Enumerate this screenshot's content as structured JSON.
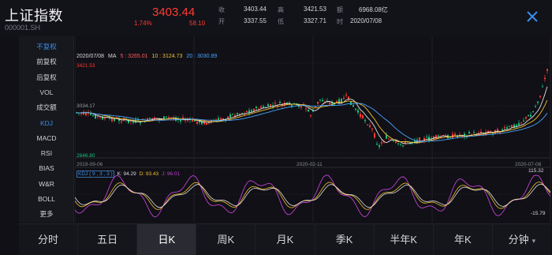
{
  "header": {
    "name": "上证指数",
    "code": "000001.SH",
    "price": "3403.44",
    "change_pct": "1.74%",
    "change": "58.10",
    "stats": [
      {
        "label": "收",
        "value": "3403.44"
      },
      {
        "label": "高",
        "value": "3421.53"
      },
      {
        "label": "额",
        "value": "6968.08亿"
      },
      {
        "label": "开",
        "value": "3337.55"
      },
      {
        "label": "低",
        "value": "3327.71"
      },
      {
        "label": "时",
        "value": "2020/07/08"
      }
    ]
  },
  "menu": {
    "items": [
      {
        "label": "不复权",
        "active": true
      },
      {
        "label": "前复权",
        "active": false
      },
      {
        "label": "后复权",
        "active": false
      },
      {
        "label": "VOL",
        "active": false
      },
      {
        "label": "成交额",
        "active": false
      },
      {
        "label": "KDJ",
        "active": true
      },
      {
        "label": "MACD",
        "active": false
      },
      {
        "label": "RSI",
        "active": false
      },
      {
        "label": "BIAS",
        "active": false
      },
      {
        "label": "W&R",
        "active": false
      },
      {
        "label": "BOLL",
        "active": false
      },
      {
        "label": "更多",
        "active": false
      }
    ]
  },
  "chart": {
    "date": "2020/07/08",
    "ma": {
      "label": "MA",
      "ma5": "5 : 3265.01",
      "ma10": "10 : 3124.73",
      "ma20": "20 : 3030.89"
    },
    "price_high_label": "3421.53",
    "price_mid_label": "3034.17",
    "price_low_label": "2646.80",
    "dates": [
      "2019-09-06",
      "2020-02-11",
      "2020-07-08"
    ],
    "kdj": {
      "params": "KDJ ( 9 , 3 , 3 )",
      "k": "K: 94.29",
      "d": "D: 93.43",
      "j": "J: 96.01",
      "top": "115.32",
      "bottom": "-15.79"
    },
    "colors": {
      "up": "#ff3b30",
      "down": "#19c37d",
      "ma5": "#e0e0e0",
      "ma10": "#f0c030",
      "ma20": "#4aa3ff",
      "j": "#c040d0"
    }
  },
  "chart_data": {
    "type": "line",
    "x": [
      "2019-09-06",
      "2020-02-11",
      "2020-07-08"
    ],
    "ylim": [
      2646.8,
      3421.53
    ],
    "series": [
      {
        "name": "close",
        "values": [
          3034.17,
          2900,
          3403.44
        ]
      }
    ]
  },
  "tabs": [
    {
      "label": "分时",
      "active": false
    },
    {
      "label": "五日",
      "active": false
    },
    {
      "label": "日K",
      "active": true
    },
    {
      "label": "周K",
      "active": false
    },
    {
      "label": "月K",
      "active": false
    },
    {
      "label": "季K",
      "active": false
    },
    {
      "label": "半年K",
      "active": false
    },
    {
      "label": "年K",
      "active": false
    },
    {
      "label": "分钟",
      "active": false,
      "caret": "▾"
    }
  ]
}
